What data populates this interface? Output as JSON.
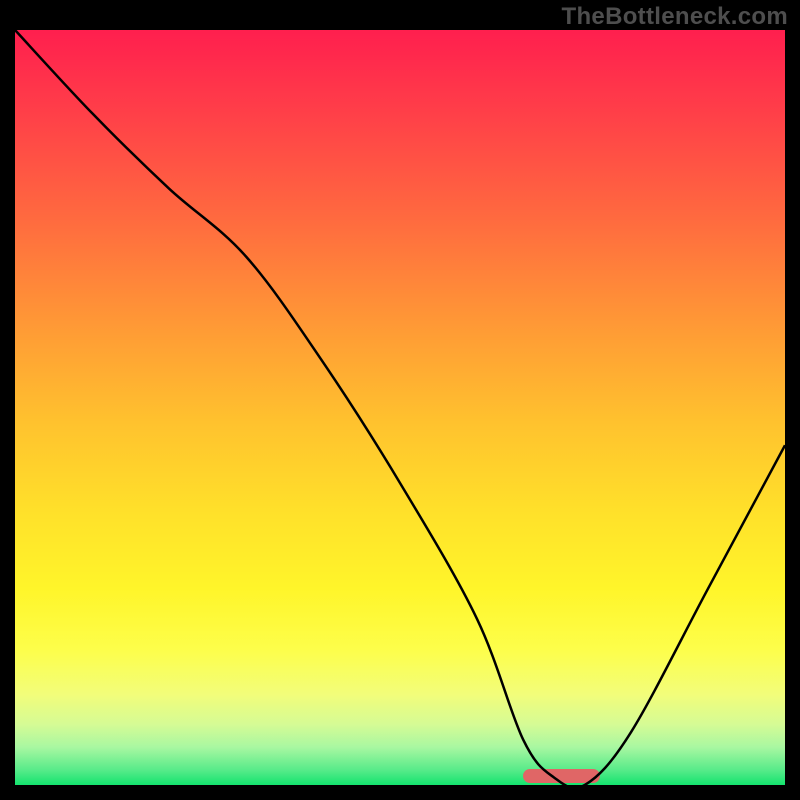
{
  "watermark": "TheBottleneck.com",
  "chart_data": {
    "type": "line",
    "title": "",
    "xlabel": "",
    "ylabel": "",
    "xlim": [
      0,
      100
    ],
    "ylim": [
      0,
      100
    ],
    "series": [
      {
        "name": "bottleneck-curve",
        "x": [
          0,
          10,
          20,
          30,
          40,
          50,
          60,
          66,
          70,
          74,
          80,
          90,
          100
        ],
        "values": [
          100,
          89,
          79,
          70,
          56,
          40,
          22,
          6,
          1,
          0,
          7,
          26,
          45
        ]
      }
    ],
    "optimum_marker": {
      "x_start": 66,
      "x_end": 76,
      "color": "#e06666"
    },
    "gradient_colors": {
      "top": "#ff1f4e",
      "mid": "#ffd733",
      "bottom": "#14e36e"
    }
  }
}
